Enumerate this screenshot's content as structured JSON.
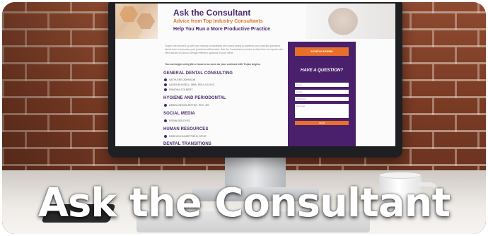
{
  "banner_title": "Ask the Consultant",
  "screen": {
    "title": "Ask the Consultant",
    "subtitle_1": "Advice from Top Industry Consultants",
    "subtitle_2": "Help You Run a More Productive Practice",
    "intro": "Trojan has teamed up with top industry consultants who stand ready to address your specific questions about how to increase your practices efficiencies. Ask the Consultant provides a direct line to experts who offer advice on how to design effective systems in your office.",
    "intro_2": "You can begin using this resource as soon as your contract with Trojan begins.",
    "sections": [
      {
        "heading": "GENERAL DENTAL CONSULTING",
        "items": [
          "KATHLEEN JOHNSON",
          "LAURA RUSSELL, MBA, RDH, A.D.M.D.",
          "RAMONA COLBERT"
        ]
      },
      {
        "heading": "HYGIENE AND PERIODONTAL",
        "items": [
          "DEBRA SEIDEL-BITTKE, RDH, BS"
        ]
      },
      {
        "heading": "SOCIAL MEDIA",
        "items": [
          "ROBIN BEDOYES"
        ]
      },
      {
        "heading": "HUMAN RESOURCES",
        "items": [
          "REBECCA BOARTFIELD, SPHR"
        ]
      },
      {
        "heading": "DENTAL TRANSITIONS",
        "items": []
      }
    ],
    "form": {
      "schedule_button": "SCHEDULE DEMO",
      "heading": "HAVE A QUESTION?",
      "fields": [
        "Name",
        "Email",
        "Telephone"
      ],
      "message_placeholder": "Message",
      "send_button": "SEND"
    }
  },
  "colors": {
    "purple": "#4a1f6b",
    "orange": "#e8702a",
    "brick": "#7c3c25"
  }
}
